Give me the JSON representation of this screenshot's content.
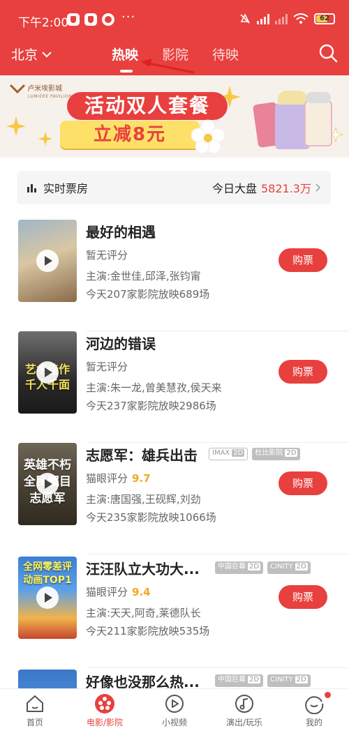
{
  "status_bar": {
    "time": "下午2:00",
    "dots": "···",
    "battery": "62"
  },
  "header": {
    "city": "北京",
    "tabs": [
      {
        "label": "热映",
        "active": true
      },
      {
        "label": "影院",
        "active": false
      },
      {
        "label": "待映",
        "active": false
      }
    ]
  },
  "banner": {
    "logo_name": "卢米埃影城",
    "logo_sub": "LUMIERE PAVILIONS",
    "headline": "活动双人套餐",
    "offer": "立减8元"
  },
  "box_office": {
    "label": "实时票房",
    "today_label": "今日大盘",
    "amount": "5821.3万"
  },
  "movies": [
    {
      "title": "最好的相遇",
      "tags": [],
      "score_label": "暂无评分",
      "score": "",
      "cast": "主演:金世佳,邱泽,张钧甯",
      "showing": "今天207家影院放映689场",
      "buy": "购票",
      "poster_text": ""
    },
    {
      "title": "河边的错误",
      "tags": [],
      "score_label": "暂无评分",
      "score": "",
      "cast": "主演:朱一龙,曾美慧孜,侯天来",
      "showing": "今天237家影院放映2986场",
      "buy": "购票",
      "poster_text": "艺术佳作 千人千面"
    },
    {
      "title": "志愿军：雄兵出击",
      "tags": [
        {
          "name": "IMAX",
          "fmt": "2D",
          "outline": true
        },
        {
          "name": "杜比影院",
          "fmt": "2D",
          "outline": false
        }
      ],
      "score_label": "猫眼评分",
      "score": "9.7",
      "cast": "主演:唐国强,王砚辉,刘劲",
      "showing": "今天235家影院放映1066场",
      "buy": "购票",
      "poster_text": "英雄不朽 全民瞩目 志愿军"
    },
    {
      "title": "汪汪队立大功大...",
      "tags": [
        {
          "name": "中国巨幕",
          "fmt": "2D",
          "outline": false
        },
        {
          "name": "CINITY",
          "fmt": "2D",
          "outline": false
        }
      ],
      "score_label": "猫眼评分",
      "score": "9.4",
      "cast": "主演:天天,阿奇,莱德队长",
      "showing": "今天211家影院放映535场",
      "buy": "购票",
      "poster_text": "全网零差评 动画TOP1"
    },
    {
      "title": "好像也没那么热...",
      "tags": [
        {
          "name": "中国巨幕",
          "fmt": "2D",
          "outline": false
        },
        {
          "name": "CINITY",
          "fmt": "2D",
          "outline": false
        }
      ],
      "score_label": "",
      "score": "",
      "cast": "",
      "showing": "",
      "buy": "",
      "poster_text": ""
    }
  ],
  "bottom_nav": [
    {
      "label": "首页",
      "icon": "home-icon"
    },
    {
      "label": "电影/影院",
      "icon": "film-reel-icon",
      "active": true
    },
    {
      "label": "小视频",
      "icon": "play-circle-icon"
    },
    {
      "label": "演出/玩乐",
      "icon": "music-note-icon"
    },
    {
      "label": "我的",
      "icon": "profile-smile-icon"
    }
  ],
  "colors": {
    "brand_red": "#e8403e",
    "score_gold": "#f5a623",
    "banner_yellow": "#fde068"
  }
}
